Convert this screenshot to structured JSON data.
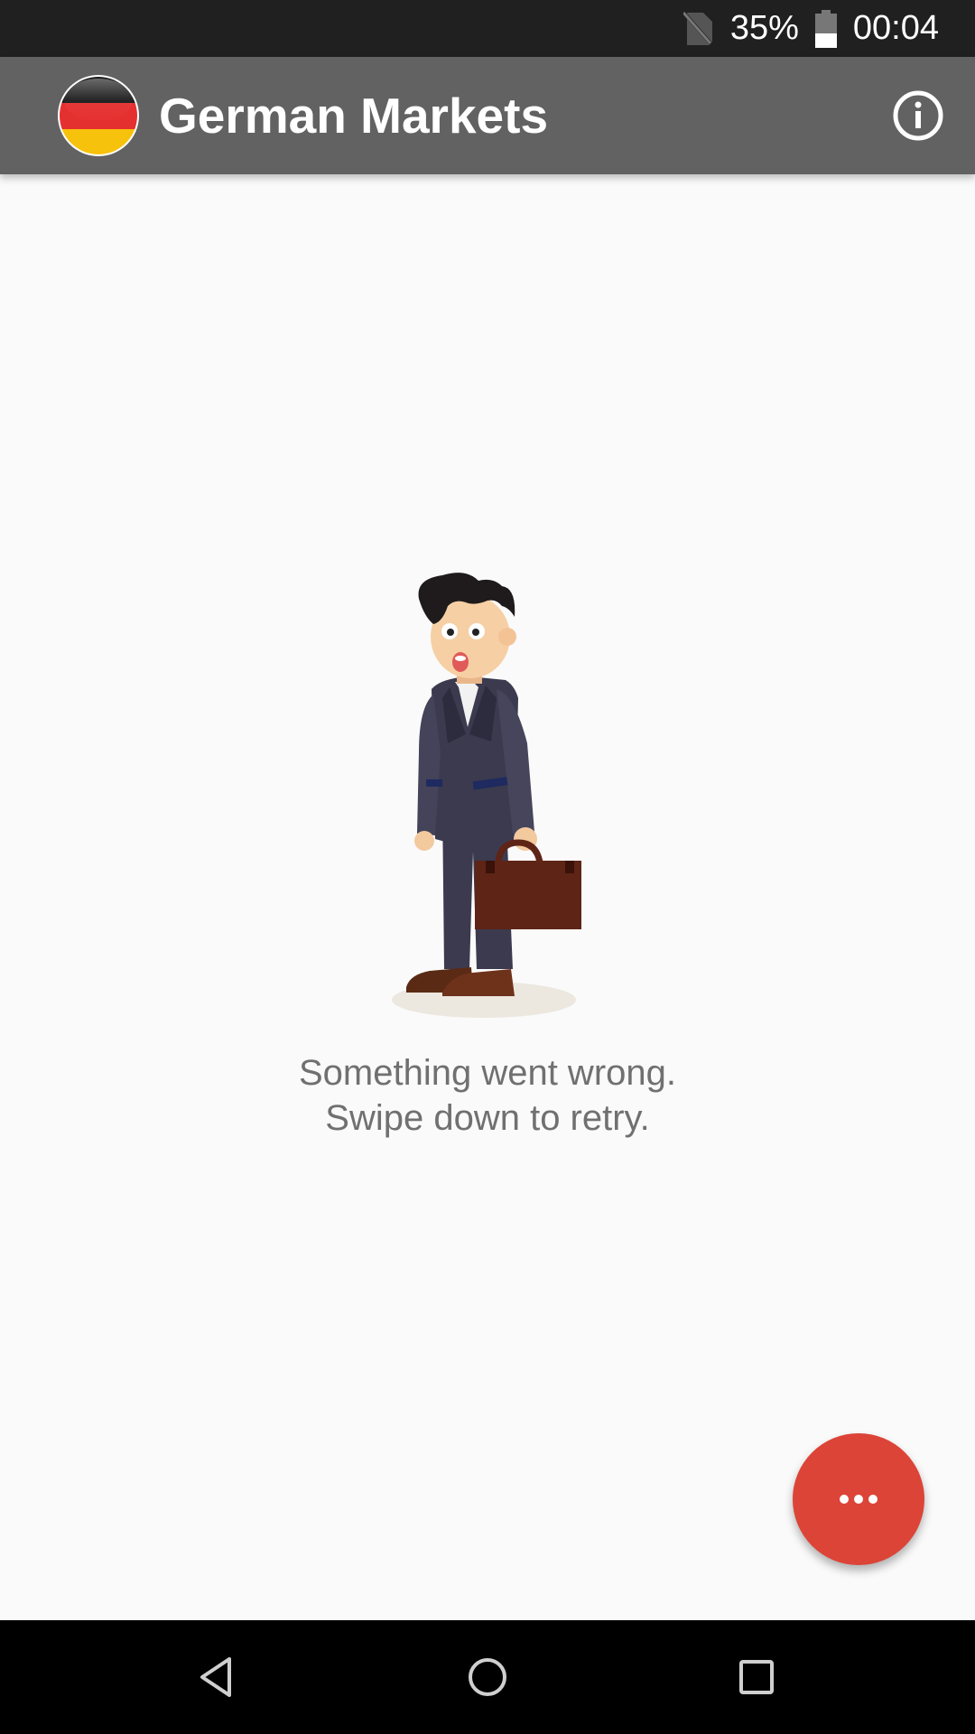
{
  "status_bar": {
    "battery_percent": "35%",
    "time": "00:04",
    "icons": [
      "no-sim-icon",
      "battery-icon"
    ]
  },
  "app_bar": {
    "title": "German Markets",
    "flag_icon": "germany-flag-icon",
    "info_icon": "info-icon"
  },
  "error": {
    "line1": "Something went wrong.",
    "line2": "Swipe down to retry."
  },
  "fab": {
    "icon": "more-horizontal-icon",
    "color": "#dc4437"
  },
  "nav_bar": {
    "icons": [
      "back-icon",
      "home-icon",
      "recents-icon"
    ]
  },
  "colors": {
    "status_bar": "#202020",
    "app_bar": "#626262",
    "background": "#fafafa",
    "message_text": "#707070",
    "accent": "#dc4437"
  }
}
